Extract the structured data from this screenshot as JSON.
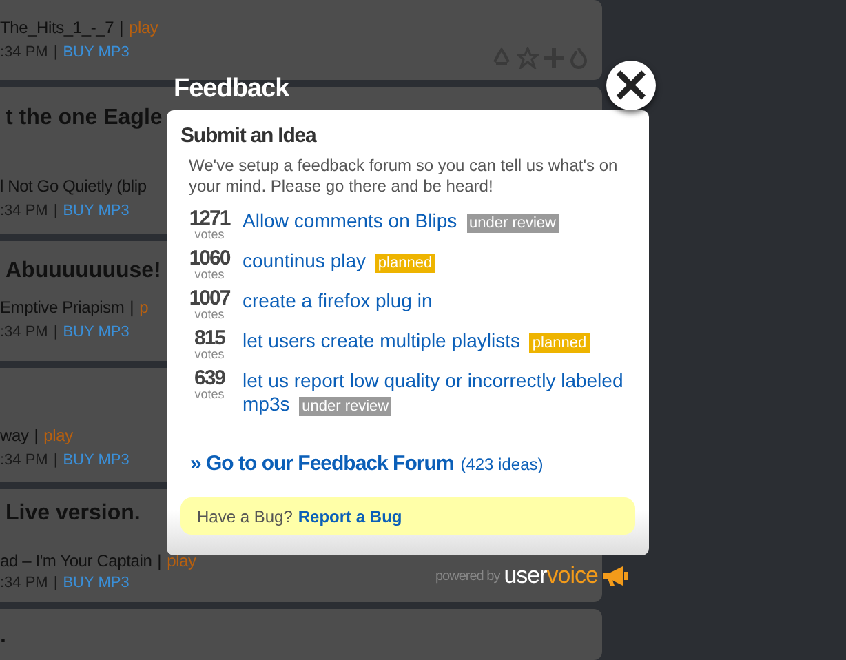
{
  "background_cards": [
    {
      "has_actions": true,
      "lines": [
        {
          "kind": "track",
          "text": "The_Hits_1_-_7",
          "separator": "|",
          "link": "play"
        },
        {
          "kind": "meta",
          "text": ":34 PM",
          "separator": "|",
          "link": "BUY MP3"
        }
      ]
    },
    {
      "lines": [
        {
          "kind": "headline",
          "text": "t the one Eagle"
        },
        {
          "kind": "track",
          "text": "l Not Go Quietly (blip"
        },
        {
          "kind": "meta",
          "text": ":34 PM",
          "separator": "|",
          "link": "BUY MP3"
        }
      ]
    },
    {
      "lines": [
        {
          "kind": "headline",
          "text": "Abuuuuuuuse!"
        },
        {
          "kind": "track",
          "text": "Emptive Priapism",
          "separator": "|",
          "link": "p"
        },
        {
          "kind": "meta",
          "text": ":34 PM",
          "separator": "|",
          "link": "BUY MP3"
        }
      ]
    },
    {
      "lines": [
        {
          "kind": "track",
          "text": "way",
          "separator": "|",
          "link": "play"
        },
        {
          "kind": "meta",
          "text": ":34 PM",
          "separator": "|",
          "link": "BUY MP3"
        }
      ]
    },
    {
      "lines": [
        {
          "kind": "headline",
          "text": "Live version."
        },
        {
          "kind": "track",
          "text": "ad – I'm Your Captain",
          "separator": "|",
          "link": "play"
        },
        {
          "kind": "meta",
          "text": ":34 PM",
          "separator": "|",
          "link": "BUY MP3"
        }
      ]
    },
    {
      "lines": [
        {
          "kind": "headline",
          "text": "."
        }
      ]
    }
  ],
  "modal": {
    "title": "Feedback",
    "close": "×",
    "heading": "Submit an Idea",
    "description": "We've setup a feedback forum so you can tell us what's on your mind. Please go there and be heard!",
    "ideas": [
      {
        "votes": "1271",
        "votes_label": "votes",
        "title": "Allow comments on Blips",
        "status": "under review",
        "kind": "review"
      },
      {
        "votes": "1060",
        "votes_label": "votes",
        "title": "countinus play",
        "status": "planned",
        "kind": "planned"
      },
      {
        "votes": "1007",
        "votes_label": "votes",
        "title": "create a firefox plug in"
      },
      {
        "votes": "815",
        "votes_label": "votes",
        "title": "let users create multiple playlists",
        "status": "planned",
        "kind": "planned"
      },
      {
        "votes": "639",
        "votes_label": "votes",
        "title": "let us report low quality or incorrectly labeled mp3s",
        "status": "under review",
        "kind": "review"
      }
    ],
    "forum_link": "» Go to our Feedback Forum",
    "forum_count": "(423 ideas)",
    "bug_prompt": "Have a Bug?",
    "bug_link": "Report a Bug",
    "powered_by": "powered by",
    "brand_part1": "user",
    "brand_part2": "voice"
  }
}
